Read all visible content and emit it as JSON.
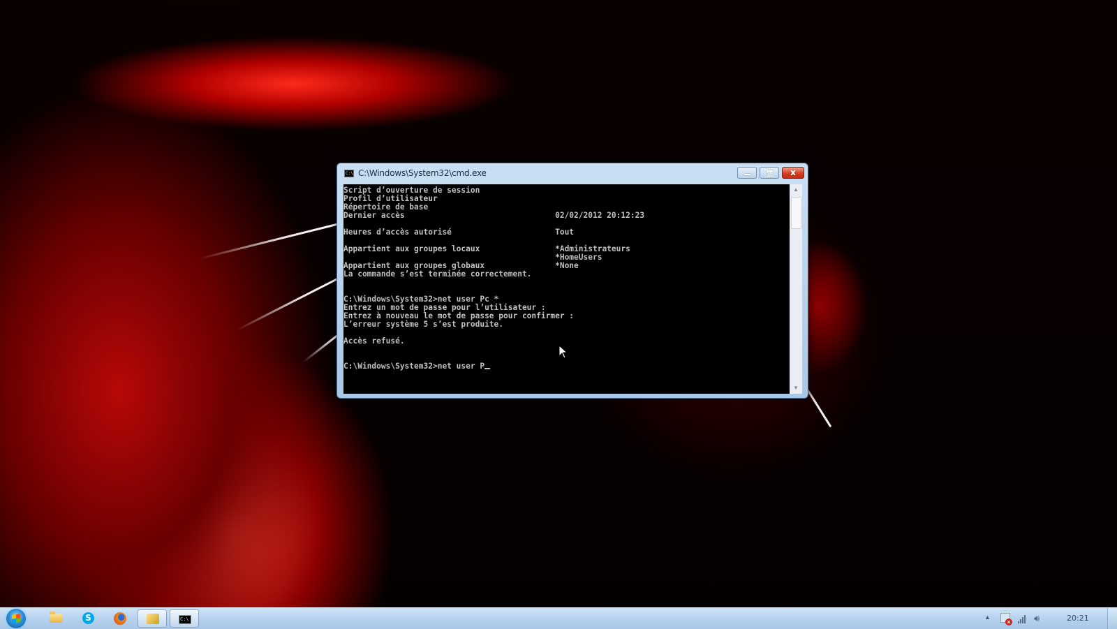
{
  "window": {
    "title": "C:\\Windows\\System32\\cmd.exe",
    "close_glyph": "x"
  },
  "console": {
    "lines": [
      "Script d’ouverture de session",
      "Profil d’utilisateur",
      "Répertoire de base",
      "Dernier accès                                02/02/2012 20:12:23",
      "",
      "Heures d’accès autorisé                      Tout",
      "",
      "Appartient aux groupes locaux                *Administrateurs",
      "                                             *HomeUsers",
      "Appartient aux groupes globaux               *None",
      "La commande s’est terminée correctement.",
      "",
      "",
      "C:\\Windows\\System32>net user Pc *",
      "Entrez un mot de passe pour l’utilisateur :",
      "Entrez à nouveau le mot de passe pour confirmer :",
      "L’erreur système 5 s’est produite.",
      "",
      "Accès refusé.",
      "",
      ""
    ],
    "prompt": "C:\\Windows\\System32>net user P"
  },
  "taskbar": {
    "items": [
      {
        "name": "windows-explorer",
        "icon": "folder-icon"
      },
      {
        "name": "skype",
        "icon": "skype-icon",
        "glyph": "S"
      },
      {
        "name": "firefox",
        "icon": "firefox-icon"
      },
      {
        "name": "file-manager",
        "icon": "explorer-icon"
      },
      {
        "name": "cmd",
        "icon": "cmd-icon",
        "glyph": "C:\\"
      }
    ],
    "clock": "20:21"
  },
  "colors": {
    "console_bg": "#000000",
    "console_fg": "#c0c0c0",
    "close_button": "#c72a10",
    "taskbar": "#b7d2ee"
  }
}
